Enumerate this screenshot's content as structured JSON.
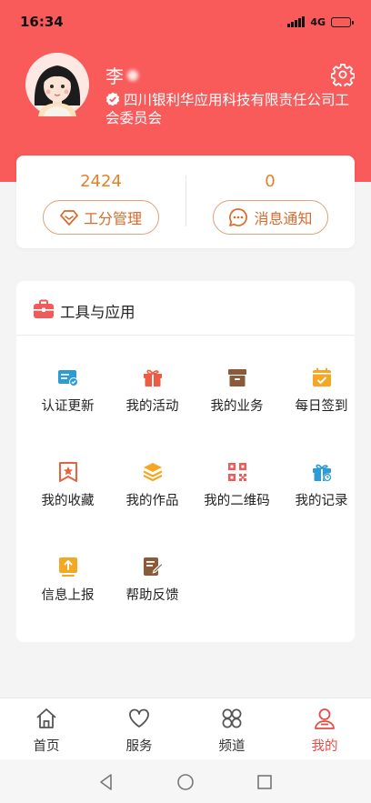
{
  "status_bar": {
    "time": "16:34",
    "network": "4G",
    "battery_level": 0.75
  },
  "profile": {
    "name": "李",
    "organization": "四川银利华应用科技有限责任公司工会委员会"
  },
  "stats": [
    {
      "value": "2424",
      "label": "工分管理",
      "icon": "diamond-icon"
    },
    {
      "value": "0",
      "label": "消息通知",
      "icon": "chat-bubble-icon"
    }
  ],
  "tools": {
    "title": "工具与应用",
    "title_icon": "briefcase-icon",
    "items": [
      {
        "label": "认证更新",
        "icon": "id-card-check-icon",
        "color": "#2d9bd8"
      },
      {
        "label": "我的活动",
        "icon": "gift-box-icon",
        "color": "#ef5a42"
      },
      {
        "label": "我的业务",
        "icon": "archive-box-icon",
        "color": "#8a5a3b"
      },
      {
        "label": "每日签到",
        "icon": "calendar-check-icon",
        "color": "#f5a623"
      },
      {
        "label": "我的收藏",
        "icon": "bookmark-star-icon",
        "color": "#e8623e"
      },
      {
        "label": "我的作品",
        "icon": "layers-icon",
        "color": "#f5a623"
      },
      {
        "label": "我的二维码",
        "icon": "qr-code-icon",
        "color": "#ef5a5a"
      },
      {
        "label": "我的记录",
        "icon": "gift-clock-icon",
        "color": "#2d9bd8"
      },
      {
        "label": "信息上报",
        "icon": "upload-tray-icon",
        "color": "#f5a623"
      },
      {
        "label": "帮助反馈",
        "icon": "edit-note-icon",
        "color": "#8a5a3b"
      }
    ]
  },
  "tabbar": {
    "items": [
      {
        "label": "首页",
        "icon": "home-icon",
        "active": false
      },
      {
        "label": "服务",
        "icon": "heart-icon",
        "active": false
      },
      {
        "label": "频道",
        "icon": "four-petal-icon",
        "active": false
      },
      {
        "label": "我的",
        "icon": "user-icon",
        "active": true
      }
    ]
  },
  "colors": {
    "brand": "#f95a5a",
    "accent": "#e0822a",
    "active_tab": "#ea4a46"
  }
}
